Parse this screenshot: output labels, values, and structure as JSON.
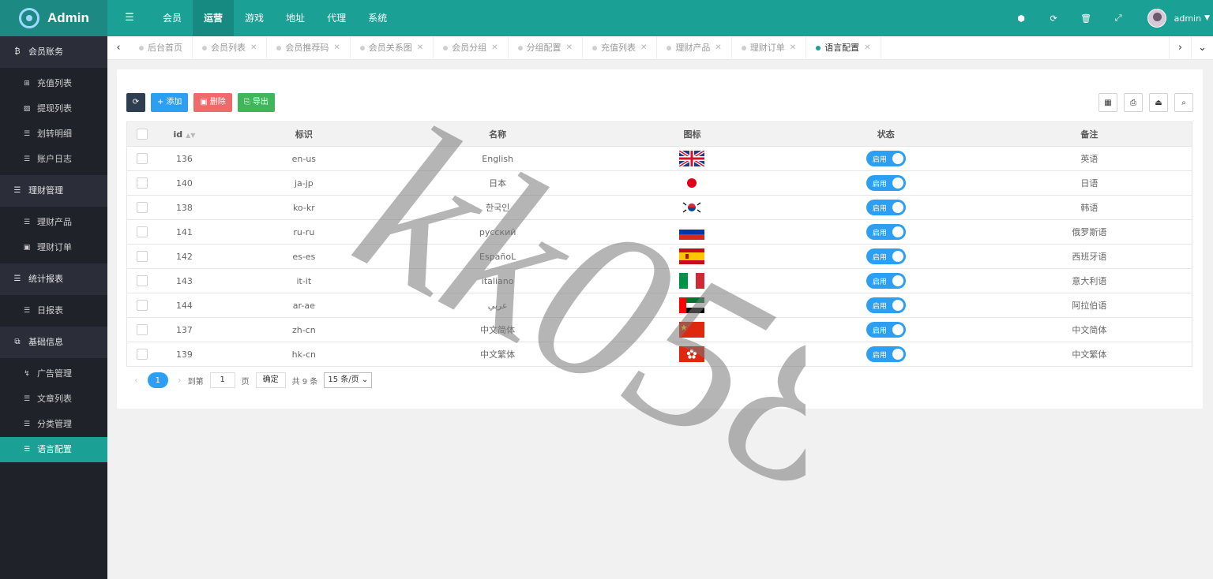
{
  "app": {
    "title": "Admin"
  },
  "topnav": {
    "items": [
      {
        "label": "会员",
        "active": false
      },
      {
        "label": "运营",
        "active": true
      },
      {
        "label": "游戏",
        "active": false
      },
      {
        "label": "地址",
        "active": false
      },
      {
        "label": "代理",
        "active": false
      },
      {
        "label": "系统",
        "active": false
      }
    ],
    "user": "admin"
  },
  "sidebar": {
    "groups": [
      {
        "label": "会员账务",
        "icon": "bitcoin-icon",
        "items": [
          {
            "label": "充值列表",
            "icon": "plus-square-icon"
          },
          {
            "label": "提现列表",
            "icon": "image-icon"
          },
          {
            "label": "划转明细",
            "icon": "list-icon"
          },
          {
            "label": "账户日志",
            "icon": "list-icon"
          }
        ]
      },
      {
        "label": "理财管理",
        "icon": "list-icon",
        "items": [
          {
            "label": "理财产品",
            "icon": "list-icon"
          },
          {
            "label": "理财订单",
            "icon": "square-icon"
          }
        ]
      },
      {
        "label": "统计报表",
        "icon": "list-icon",
        "items": [
          {
            "label": "日报表",
            "icon": "list-icon"
          }
        ]
      },
      {
        "label": "基础信息",
        "icon": "copy-icon",
        "items": [
          {
            "label": "广告管理",
            "icon": "ad-icon"
          },
          {
            "label": "文章列表",
            "icon": "list-icon"
          },
          {
            "label": "分类管理",
            "icon": "list-icon"
          },
          {
            "label": "语言配置",
            "icon": "list-icon",
            "active": true
          }
        ]
      }
    ]
  },
  "tabs": [
    {
      "label": "后台首页",
      "closable": false,
      "active": false
    },
    {
      "label": "会员列表",
      "closable": true,
      "active": false
    },
    {
      "label": "会员推荐码",
      "closable": true,
      "active": false
    },
    {
      "label": "会员关系图",
      "closable": true,
      "active": false
    },
    {
      "label": "会员分组",
      "closable": true,
      "active": false
    },
    {
      "label": "分组配置",
      "closable": true,
      "active": false
    },
    {
      "label": "充值列表",
      "closable": true,
      "active": false
    },
    {
      "label": "理财产品",
      "closable": true,
      "active": false
    },
    {
      "label": "理财订单",
      "closable": true,
      "active": false
    },
    {
      "label": "语言配置",
      "closable": true,
      "active": true
    }
  ],
  "toolbar": {
    "add_label": "添加",
    "delete_label": "删除",
    "export_label": "导出"
  },
  "table": {
    "headers": [
      "id",
      "标识",
      "名称",
      "图标",
      "状态",
      "备注"
    ],
    "rows": [
      {
        "id": "136",
        "code": "en-us",
        "name": "English",
        "flag": "uk",
        "status": "启用",
        "note": "英语"
      },
      {
        "id": "140",
        "code": "ja-jp",
        "name": "日本",
        "flag": "jp",
        "status": "启用",
        "note": "日语"
      },
      {
        "id": "138",
        "code": "ko-kr",
        "name": "한국인",
        "flag": "kr",
        "status": "启用",
        "note": "韩语"
      },
      {
        "id": "141",
        "code": "ru-ru",
        "name": "русский",
        "flag": "ru",
        "status": "启用",
        "note": "俄罗斯语"
      },
      {
        "id": "142",
        "code": "es-es",
        "name": "EspañoL",
        "flag": "es",
        "status": "启用",
        "note": "西班牙语"
      },
      {
        "id": "143",
        "code": "it-it",
        "name": "italiano",
        "flag": "it",
        "status": "启用",
        "note": "意大利语"
      },
      {
        "id": "144",
        "code": "ar-ae",
        "name": "عربي",
        "flag": "ae",
        "status": "启用",
        "note": "阿拉伯语"
      },
      {
        "id": "137",
        "code": "zh-cn",
        "name": "中文简体",
        "flag": "cn",
        "status": "启用",
        "note": "中文简体"
      },
      {
        "id": "139",
        "code": "hk-cn",
        "name": "中文繁体",
        "flag": "hk",
        "status": "启用",
        "note": "中文繁体"
      }
    ]
  },
  "pager": {
    "current": "1",
    "goto_label": "到第",
    "page_input": "1",
    "page_unit": "页",
    "confirm": "确定",
    "total": "共 9 条",
    "per_page": "15 条/页"
  },
  "watermark": "kk058",
  "colors": {
    "primary": "#1aa094",
    "blue": "#2d9ff3",
    "danger": "#ed6b6b",
    "success": "#3fb65a",
    "dark": "#20222a"
  }
}
